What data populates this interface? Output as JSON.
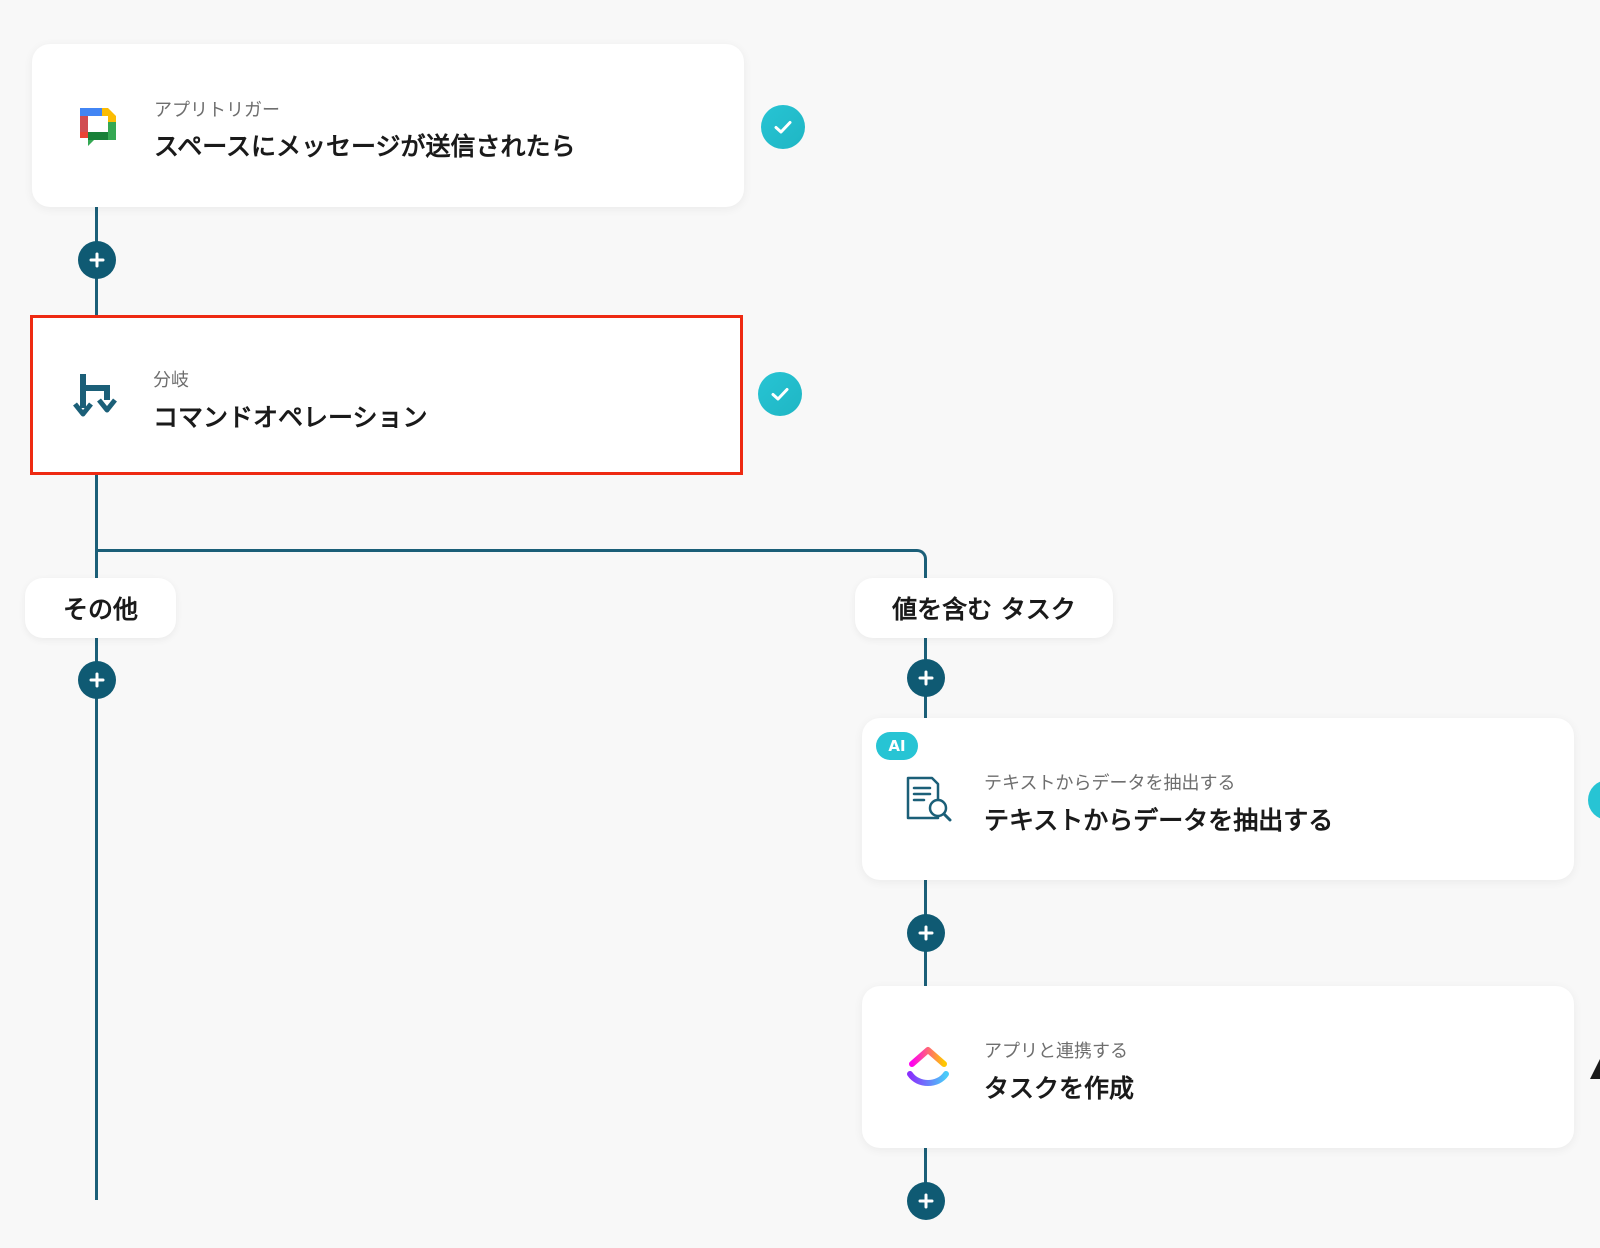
{
  "trigger": {
    "subtitle": "アプリトリガー",
    "title": "スペースにメッセージが送信されたら",
    "icon": "google-chat-icon"
  },
  "branch": {
    "subtitle": "分岐",
    "title": "コマンドオペレーション",
    "icon": "branch-icon"
  },
  "paths": {
    "other_label": "その他",
    "match_label": "値を含む タスク"
  },
  "extract": {
    "badge": "AI",
    "subtitle": "テキストからデータを抽出する",
    "title": "テキストからデータを抽出する",
    "icon": "document-search-icon"
  },
  "create_task": {
    "subtitle": "アプリと連携する",
    "title": "タスクを作成",
    "icon": "clickup-icon"
  },
  "colors": {
    "connector": "#1b5f78",
    "plus": "#0f5a73",
    "check": "#27c4d4",
    "highlight": "#ee2a12"
  }
}
